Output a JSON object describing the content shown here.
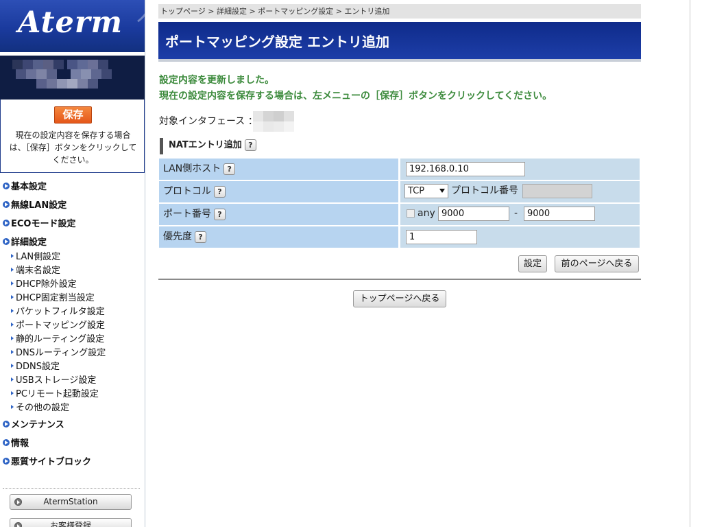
{
  "sidebar": {
    "logo": "Aterm",
    "save_button": "保存",
    "save_note": "現在の設定内容を保存する場合は、［保存］ボタンをクリックしてください。",
    "menu": {
      "basic": "基本設定",
      "wireless": "無線LAN設定",
      "eco": "ECOモード設定",
      "detail": "詳細設定",
      "detail_items": [
        "LAN側設定",
        "端末名設定",
        "DHCP除外設定",
        "DHCP固定割当設定",
        "パケットフィルタ設定",
        "ポートマッピング設定",
        "静的ルーティング設定",
        "DNSルーティング設定",
        "DDNS設定",
        "USBストレージ設定",
        "PCリモート起動設定",
        "その他の設定"
      ],
      "maintenance": "メンテナンス",
      "info": "情報",
      "malicious_block": "悪質サイトブロック"
    },
    "links": {
      "aterm_station": "AtermStation",
      "registration": "お客様登録"
    }
  },
  "breadcrumb": "トップページ > 詳細設定 > ポートマッピング設定 > エントリ追加",
  "page_title": "ポートマッピング設定 エントリ追加",
  "messages": {
    "updated": "設定内容を更新しました。",
    "save_hint": "現在の設定内容を保存する場合は、左メニューの［保存］ボタンをクリックしてください。"
  },
  "interface": {
    "label": "対象インタフェース ："
  },
  "section_title": "NATエントリ追加",
  "help_glyph": "?",
  "form": {
    "lan_host": {
      "label": "LAN側ホスト",
      "value": "192.168.0.10"
    },
    "protocol": {
      "label": "プロトコル",
      "value": "TCP",
      "number_label": "プロトコル番号",
      "number_value": ""
    },
    "port": {
      "label": "ポート番号",
      "any_label": "any",
      "from": "9000",
      "separator": "-",
      "to": "9000"
    },
    "priority": {
      "label": "優先度",
      "value": "1"
    }
  },
  "buttons": {
    "set": "設定",
    "back": "前のページへ戻る",
    "top": "トップページへ戻る"
  },
  "colors": {
    "title_bar": "#1a3aa0",
    "message_green": "#3d8b3d",
    "label_cell": "#b7d4f0",
    "value_cell": "#c8dceb",
    "save_orange": "#e86a24"
  }
}
